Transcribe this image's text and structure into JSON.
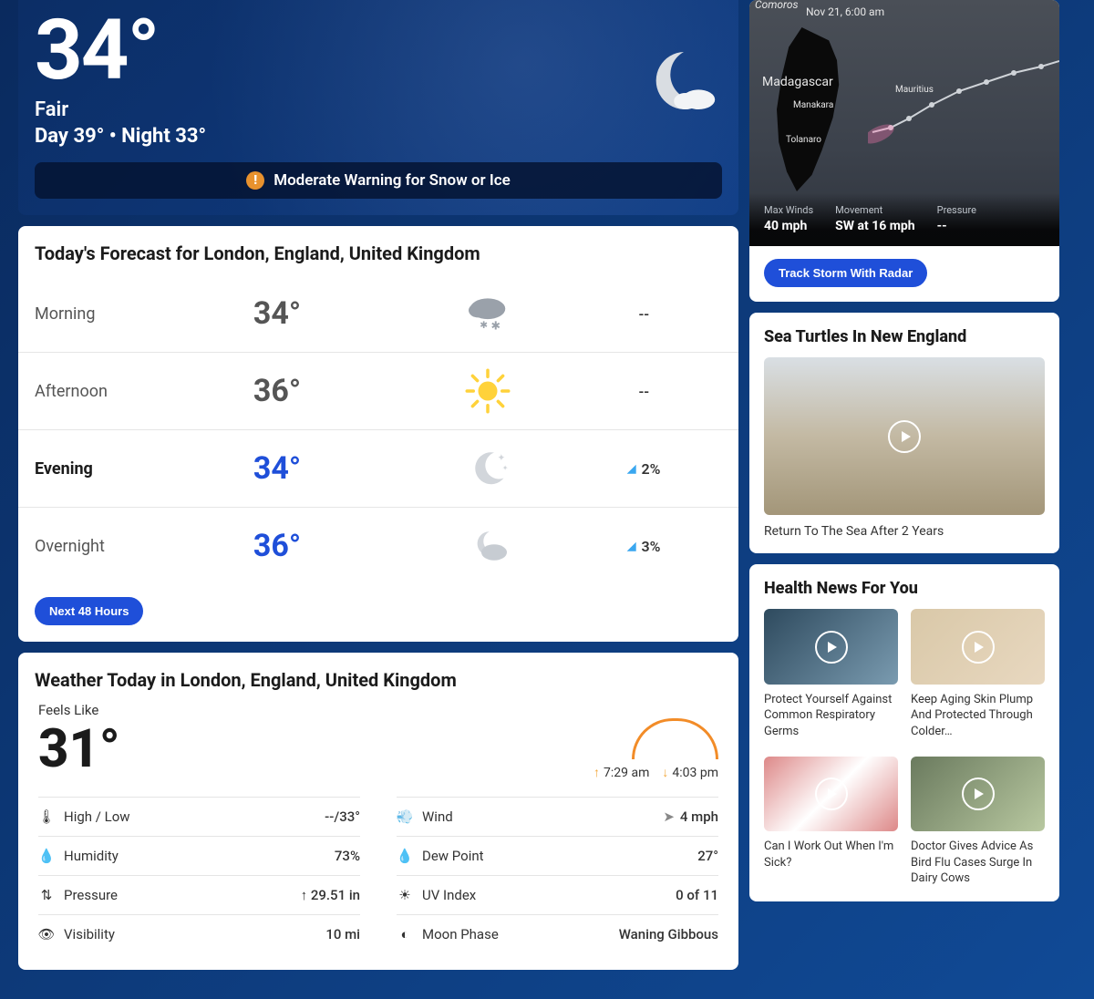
{
  "hero": {
    "temperature": "34°",
    "condition": "Fair",
    "day_label": "Day 39°",
    "night_label": "Night 33°",
    "separator": " • ",
    "alert_text": "Moderate Warning for Snow or Ice"
  },
  "forecast": {
    "title": "Today's Forecast for London, England, United Kingdom",
    "rows": [
      {
        "label": "Morning",
        "temp": "34°",
        "precip": "--",
        "icon": "snow"
      },
      {
        "label": "Afternoon",
        "temp": "36°",
        "precip": "--",
        "icon": "sunny"
      },
      {
        "label": "Evening",
        "temp": "34°",
        "precip": "2%",
        "icon": "clear-night"
      },
      {
        "label": "Overnight",
        "temp": "36°",
        "precip": "3%",
        "icon": "partly-cloudy-night"
      }
    ],
    "button": "Next 48 Hours"
  },
  "today": {
    "title": "Weather Today in London, England, United Kingdom",
    "feels_label": "Feels Like",
    "feels_value": "31°",
    "sunrise": "7:29 am",
    "sunset": "4:03 pm",
    "details": {
      "highlow_k": "High / Low",
      "highlow_v": "--/33°",
      "humidity_k": "Humidity",
      "humidity_v": "73%",
      "pressure_k": "Pressure",
      "pressure_v": "29.51 in",
      "pressure_arrow": "↑",
      "visibility_k": "Visibility",
      "visibility_v": "10 mi",
      "wind_k": "Wind",
      "wind_v": "4 mph",
      "dew_k": "Dew Point",
      "dew_v": "27°",
      "uv_k": "UV Index",
      "uv_v": "0 of 11",
      "moon_k": "Moon Phase",
      "moon_v": "Waning Gibbous"
    }
  },
  "storm": {
    "timestamp": "Nov 21, 6:00 am",
    "labels": {
      "comoros": "Comoros",
      "madagascar": "Madagascar",
      "manakara": "Manakara",
      "tolanaro": "Tolanaro",
      "mauritius": "Mauritius"
    },
    "stats": {
      "maxwinds_k": "Max Winds",
      "maxwinds_v": "40 mph",
      "movement_k": "Movement",
      "movement_v": "SW at 16 mph",
      "pressure_k": "Pressure",
      "pressure_v": "--"
    },
    "button": "Track Storm With Radar"
  },
  "turtles": {
    "title": "Sea Turtles In New England",
    "caption": "Return To The Sea After 2 Years"
  },
  "health": {
    "title": "Health News For You",
    "items": [
      "Protect Yourself Against Common Respiratory Germs",
      "Keep Aging Skin Plump And Protected Through Colder…",
      "Can I Work Out When I'm Sick?",
      "Doctor Gives Advice As Bird Flu Cases Surge In Dairy Cows"
    ]
  }
}
